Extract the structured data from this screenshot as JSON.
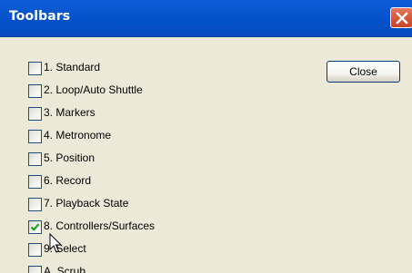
{
  "window": {
    "title": "Toolbars",
    "close_button_label": "Close"
  },
  "icons": {
    "window_close": "close-icon",
    "check": "checkmark-icon",
    "cursor": "mouse-pointer-icon"
  },
  "colors": {
    "titlebar": "#0a57d0",
    "window_close": "#d8583a",
    "check": "#21a121",
    "face": "#ece9d8"
  },
  "items": [
    {
      "label": "1. Standard",
      "checked": false
    },
    {
      "label": "2. Loop/Auto Shuttle",
      "checked": false
    },
    {
      "label": "3. Markers",
      "checked": false
    },
    {
      "label": "4. Metronome",
      "checked": false
    },
    {
      "label": "5. Position",
      "checked": false
    },
    {
      "label": "6. Record",
      "checked": false
    },
    {
      "label": "7. Playback State",
      "checked": false
    },
    {
      "label": "8. Controllers/Surfaces",
      "checked": true
    },
    {
      "label": "9. Select",
      "checked": false
    },
    {
      "label": "A. Scrub",
      "checked": false
    }
  ]
}
